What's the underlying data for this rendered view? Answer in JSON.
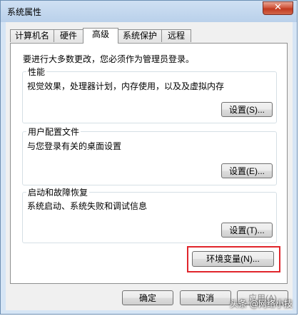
{
  "window": {
    "title": "系统属性",
    "close_symbol": "✕"
  },
  "tabs": [
    {
      "label": "计算机名"
    },
    {
      "label": "硬件"
    },
    {
      "label": "高级"
    },
    {
      "label": "系统保护"
    },
    {
      "label": "远程"
    }
  ],
  "active_tab": "高级",
  "panel": {
    "intro": "要进行大多数更改，您必须作为管理员登录。",
    "performance": {
      "title": "性能",
      "desc": "视觉效果，处理器计划，内存使用，以及及虚拟内存",
      "button": "设置(S)..."
    },
    "profile": {
      "title": "用户配置文件",
      "desc": "与您登录有关的桌面设置",
      "button": "设置(E)..."
    },
    "startup": {
      "title": "启动和故障恢复",
      "desc": "系统启动、系统失败和调试信息",
      "button": "设置(T)..."
    },
    "env_button": "环境变量(N)..."
  },
  "footer": {
    "ok": "确定",
    "cancel": "取消",
    "apply": "应用(A)"
  },
  "watermark": "头条 @网络小技",
  "colors": {
    "highlight": "#e0252b",
    "close": "#c23a20"
  }
}
